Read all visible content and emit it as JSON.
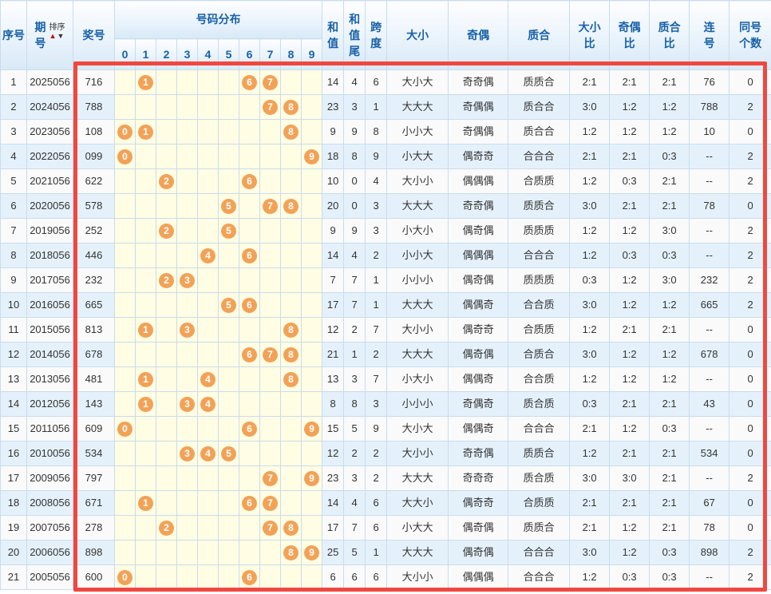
{
  "colors": {
    "header_text": "#1861A8",
    "header_bg_top": "#FEFEFF",
    "header_bg_bottom": "#D8E9F7",
    "grid_border": "#C9DCEC",
    "row_even_bg": "#E4F1FB",
    "row_odd_bg": "#FAFAFA",
    "dist_bg": "#FFFDE4",
    "ball_bg": "#F2A257",
    "highlight_box": "#F04840"
  },
  "header": {
    "no": "序号",
    "issue": "期\n号",
    "sort_label": "排序",
    "sort_up": "▲",
    "sort_down": "▼",
    "num": "奖号",
    "dist": "号码分布",
    "digits": [
      "0",
      "1",
      "2",
      "3",
      "4",
      "5",
      "6",
      "7",
      "8",
      "9"
    ],
    "sum": "和\n值",
    "tail": "和\n值\n尾",
    "span": "跨\n度",
    "size": "大小",
    "parity": "奇偶",
    "prime": "质合",
    "size_ratio": "大小\n比",
    "parity_ratio": "奇偶\n比",
    "prime_ratio": "质合\n比",
    "consec": "连\n号",
    "same": "同号\n个数"
  },
  "rows": [
    {
      "no": "1",
      "issue": "2025056",
      "num": "716",
      "balls": [
        1,
        6,
        7
      ],
      "sum": "14",
      "tail": "4",
      "span": "6",
      "size": "大小大",
      "parity": "奇奇偶",
      "prime": "质质合",
      "size_ratio": "2:1",
      "parity_ratio": "2:1",
      "prime_ratio": "2:1",
      "consec": "76",
      "same": "0"
    },
    {
      "no": "2",
      "issue": "2024056",
      "num": "788",
      "balls": [
        7,
        8
      ],
      "sum": "23",
      "tail": "3",
      "span": "1",
      "size": "大大大",
      "parity": "奇偶偶",
      "prime": "质合合",
      "size_ratio": "3:0",
      "parity_ratio": "1:2",
      "prime_ratio": "1:2",
      "consec": "788",
      "same": "2"
    },
    {
      "no": "3",
      "issue": "2023056",
      "num": "108",
      "balls": [
        0,
        1,
        8
      ],
      "sum": "9",
      "tail": "9",
      "span": "8",
      "size": "小小大",
      "parity": "奇偶偶",
      "prime": "质合合",
      "size_ratio": "1:2",
      "parity_ratio": "1:2",
      "prime_ratio": "1:2",
      "consec": "10",
      "same": "0"
    },
    {
      "no": "4",
      "issue": "2022056",
      "num": "099",
      "balls": [
        0,
        9
      ],
      "sum": "18",
      "tail": "8",
      "span": "9",
      "size": "小大大",
      "parity": "偶奇奇",
      "prime": "合合合",
      "size_ratio": "2:1",
      "parity_ratio": "2:1",
      "prime_ratio": "0:3",
      "consec": "--",
      "same": "2"
    },
    {
      "no": "5",
      "issue": "2021056",
      "num": "622",
      "balls": [
        2,
        6
      ],
      "sum": "10",
      "tail": "0",
      "span": "4",
      "size": "大小小",
      "parity": "偶偶偶",
      "prime": "合质质",
      "size_ratio": "1:2",
      "parity_ratio": "0:3",
      "prime_ratio": "2:1",
      "consec": "--",
      "same": "2"
    },
    {
      "no": "6",
      "issue": "2020056",
      "num": "578",
      "balls": [
        5,
        7,
        8
      ],
      "sum": "20",
      "tail": "0",
      "span": "3",
      "size": "大大大",
      "parity": "奇奇偶",
      "prime": "质质合",
      "size_ratio": "3:0",
      "parity_ratio": "2:1",
      "prime_ratio": "2:1",
      "consec": "78",
      "same": "0"
    },
    {
      "no": "7",
      "issue": "2019056",
      "num": "252",
      "balls": [
        2,
        5
      ],
      "sum": "9",
      "tail": "9",
      "span": "3",
      "size": "小大小",
      "parity": "偶奇偶",
      "prime": "质质质",
      "size_ratio": "1:2",
      "parity_ratio": "1:2",
      "prime_ratio": "3:0",
      "consec": "--",
      "same": "2"
    },
    {
      "no": "8",
      "issue": "2018056",
      "num": "446",
      "balls": [
        4,
        6
      ],
      "sum": "14",
      "tail": "4",
      "span": "2",
      "size": "小小大",
      "parity": "偶偶偶",
      "prime": "合合合",
      "size_ratio": "1:2",
      "parity_ratio": "0:3",
      "prime_ratio": "0:3",
      "consec": "--",
      "same": "2"
    },
    {
      "no": "9",
      "issue": "2017056",
      "num": "232",
      "balls": [
        2,
        3
      ],
      "sum": "7",
      "tail": "7",
      "span": "1",
      "size": "小小小",
      "parity": "偶奇偶",
      "prime": "质质质",
      "size_ratio": "0:3",
      "parity_ratio": "1:2",
      "prime_ratio": "3:0",
      "consec": "232",
      "same": "2"
    },
    {
      "no": "10",
      "issue": "2016056",
      "num": "665",
      "balls": [
        5,
        6
      ],
      "sum": "17",
      "tail": "7",
      "span": "1",
      "size": "大大大",
      "parity": "偶偶奇",
      "prime": "合合质",
      "size_ratio": "3:0",
      "parity_ratio": "1:2",
      "prime_ratio": "1:2",
      "consec": "665",
      "same": "2"
    },
    {
      "no": "11",
      "issue": "2015056",
      "num": "813",
      "balls": [
        1,
        3,
        8
      ],
      "sum": "12",
      "tail": "2",
      "span": "7",
      "size": "大小小",
      "parity": "偶奇奇",
      "prime": "合质质",
      "size_ratio": "1:2",
      "parity_ratio": "2:1",
      "prime_ratio": "2:1",
      "consec": "--",
      "same": "0"
    },
    {
      "no": "12",
      "issue": "2014056",
      "num": "678",
      "balls": [
        6,
        7,
        8
      ],
      "sum": "21",
      "tail": "1",
      "span": "2",
      "size": "大大大",
      "parity": "偶奇偶",
      "prime": "合质合",
      "size_ratio": "3:0",
      "parity_ratio": "1:2",
      "prime_ratio": "1:2",
      "consec": "678",
      "same": "0"
    },
    {
      "no": "13",
      "issue": "2013056",
      "num": "481",
      "balls": [
        1,
        4,
        8
      ],
      "sum": "13",
      "tail": "3",
      "span": "7",
      "size": "小大小",
      "parity": "偶偶奇",
      "prime": "合合质",
      "size_ratio": "1:2",
      "parity_ratio": "1:2",
      "prime_ratio": "1:2",
      "consec": "--",
      "same": "0"
    },
    {
      "no": "14",
      "issue": "2012056",
      "num": "143",
      "balls": [
        1,
        3,
        4
      ],
      "sum": "8",
      "tail": "8",
      "span": "3",
      "size": "小小小",
      "parity": "奇偶奇",
      "prime": "质合质",
      "size_ratio": "0:3",
      "parity_ratio": "2:1",
      "prime_ratio": "2:1",
      "consec": "43",
      "same": "0"
    },
    {
      "no": "15",
      "issue": "2011056",
      "num": "609",
      "balls": [
        0,
        6,
        9
      ],
      "sum": "15",
      "tail": "5",
      "span": "9",
      "size": "大小大",
      "parity": "偶偶奇",
      "prime": "合合合",
      "size_ratio": "2:1",
      "parity_ratio": "1:2",
      "prime_ratio": "0:3",
      "consec": "--",
      "same": "0"
    },
    {
      "no": "16",
      "issue": "2010056",
      "num": "534",
      "balls": [
        3,
        4,
        5
      ],
      "sum": "12",
      "tail": "2",
      "span": "2",
      "size": "大小小",
      "parity": "奇奇偶",
      "prime": "质质合",
      "size_ratio": "1:2",
      "parity_ratio": "2:1",
      "prime_ratio": "2:1",
      "consec": "534",
      "same": "0"
    },
    {
      "no": "17",
      "issue": "2009056",
      "num": "797",
      "balls": [
        7,
        9
      ],
      "sum": "23",
      "tail": "3",
      "span": "2",
      "size": "大大大",
      "parity": "奇奇奇",
      "prime": "质合质",
      "size_ratio": "3:0",
      "parity_ratio": "3:0",
      "prime_ratio": "2:1",
      "consec": "--",
      "same": "2"
    },
    {
      "no": "18",
      "issue": "2008056",
      "num": "671",
      "balls": [
        1,
        6,
        7
      ],
      "sum": "14",
      "tail": "4",
      "span": "6",
      "size": "大大小",
      "parity": "偶奇奇",
      "prime": "合质质",
      "size_ratio": "2:1",
      "parity_ratio": "2:1",
      "prime_ratio": "2:1",
      "consec": "67",
      "same": "0"
    },
    {
      "no": "19",
      "issue": "2007056",
      "num": "278",
      "balls": [
        2,
        7,
        8
      ],
      "sum": "17",
      "tail": "7",
      "span": "6",
      "size": "小大大",
      "parity": "偶奇偶",
      "prime": "质质合",
      "size_ratio": "2:1",
      "parity_ratio": "1:2",
      "prime_ratio": "2:1",
      "consec": "78",
      "same": "0"
    },
    {
      "no": "20",
      "issue": "2006056",
      "num": "898",
      "balls": [
        8,
        9
      ],
      "sum": "25",
      "tail": "5",
      "span": "1",
      "size": "大大大",
      "parity": "偶奇偶",
      "prime": "合合合",
      "size_ratio": "3:0",
      "parity_ratio": "1:2",
      "prime_ratio": "0:3",
      "consec": "898",
      "same": "2"
    },
    {
      "no": "21",
      "issue": "2005056",
      "num": "600",
      "balls": [
        0,
        6
      ],
      "sum": "6",
      "tail": "6",
      "span": "6",
      "size": "大小小",
      "parity": "偶偶偶",
      "prime": "合合合",
      "size_ratio": "1:2",
      "parity_ratio": "0:3",
      "prime_ratio": "0:3",
      "consec": "--",
      "same": "2"
    }
  ]
}
